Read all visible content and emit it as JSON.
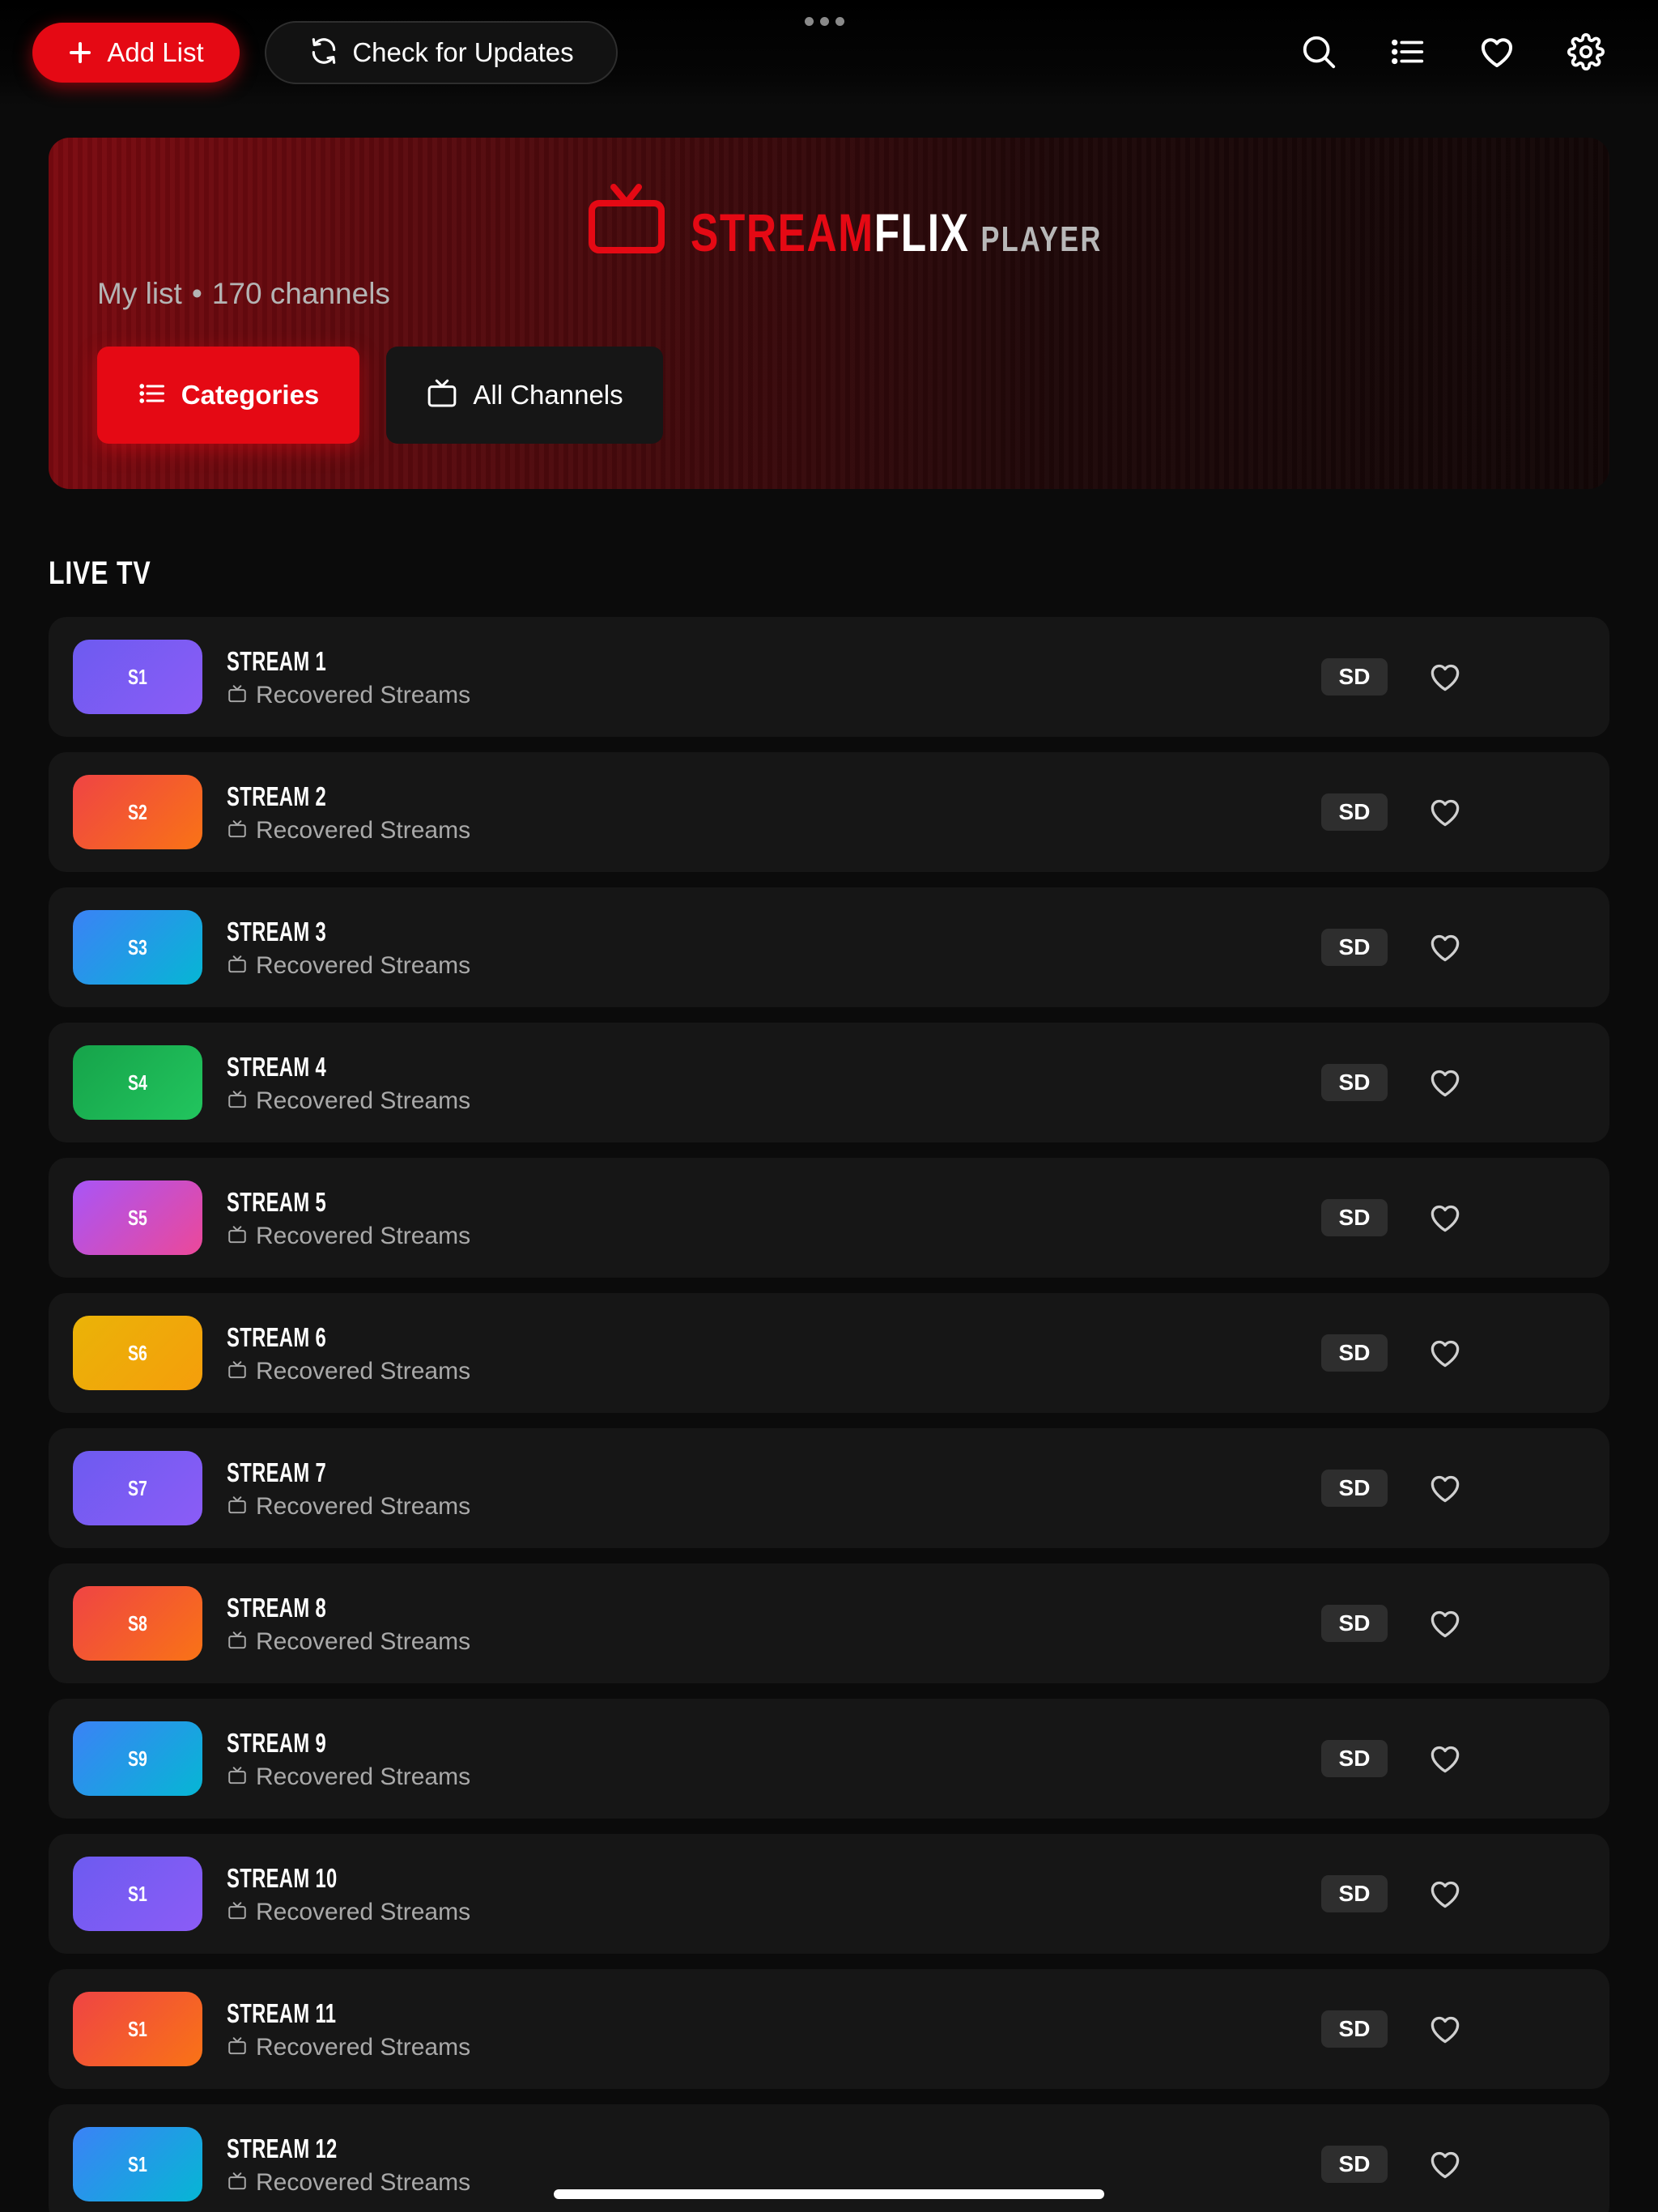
{
  "toolbar": {
    "add_list_label": "Add List",
    "check_updates_label": "Check for Updates",
    "icons": [
      "search-icon",
      "list-icon",
      "heart-icon",
      "gear-icon"
    ]
  },
  "hero": {
    "logo": {
      "stream": "STREAM",
      "flix": "FLIX",
      "player": "PLAYER"
    },
    "list_name": "My list",
    "separator": "•",
    "channel_count": "170 channels",
    "categories_label": "Categories",
    "all_channels_label": "All Channels"
  },
  "section": {
    "title": "LIVE TV"
  },
  "colors": {
    "accent": "#e50914",
    "row_background": "#161616",
    "quality_badge": "#2e2e2e"
  },
  "channels": [
    {
      "badge": "S1",
      "name": "STREAM 1",
      "category": "Recovered Streams",
      "quality": "SD",
      "gradient": [
        "#6d5bf0",
        "#8b5cf6"
      ]
    },
    {
      "badge": "S2",
      "name": "STREAM 2",
      "category": "Recovered Streams",
      "quality": "SD",
      "gradient": [
        "#ef4444",
        "#f97316"
      ]
    },
    {
      "badge": "S3",
      "name": "STREAM 3",
      "category": "Recovered Streams",
      "quality": "SD",
      "gradient": [
        "#3b82f6",
        "#06b6d4"
      ]
    },
    {
      "badge": "S4",
      "name": "STREAM 4",
      "category": "Recovered Streams",
      "quality": "SD",
      "gradient": [
        "#16a34a",
        "#22c55e"
      ]
    },
    {
      "badge": "S5",
      "name": "STREAM 5",
      "category": "Recovered Streams",
      "quality": "SD",
      "gradient": [
        "#a855f7",
        "#ec4899"
      ]
    },
    {
      "badge": "S6",
      "name": "STREAM 6",
      "category": "Recovered Streams",
      "quality": "SD",
      "gradient": [
        "#eab308",
        "#f59e0b"
      ]
    },
    {
      "badge": "S7",
      "name": "STREAM 7",
      "category": "Recovered Streams",
      "quality": "SD",
      "gradient": [
        "#6d5bf0",
        "#8b5cf6"
      ]
    },
    {
      "badge": "S8",
      "name": "STREAM 8",
      "category": "Recovered Streams",
      "quality": "SD",
      "gradient": [
        "#ef4444",
        "#f97316"
      ]
    },
    {
      "badge": "S9",
      "name": "STREAM 9",
      "category": "Recovered Streams",
      "quality": "SD",
      "gradient": [
        "#3b82f6",
        "#06b6d4"
      ]
    },
    {
      "badge": "S1",
      "name": "STREAM 10",
      "category": "Recovered Streams",
      "quality": "SD",
      "gradient": [
        "#6d5bf0",
        "#8b5cf6"
      ]
    },
    {
      "badge": "S1",
      "name": "STREAM 11",
      "category": "Recovered Streams",
      "quality": "SD",
      "gradient": [
        "#ef4444",
        "#f97316"
      ]
    },
    {
      "badge": "S1",
      "name": "STREAM 12",
      "category": "Recovered Streams",
      "quality": "SD",
      "gradient": [
        "#3b82f6",
        "#06b6d4"
      ]
    }
  ]
}
